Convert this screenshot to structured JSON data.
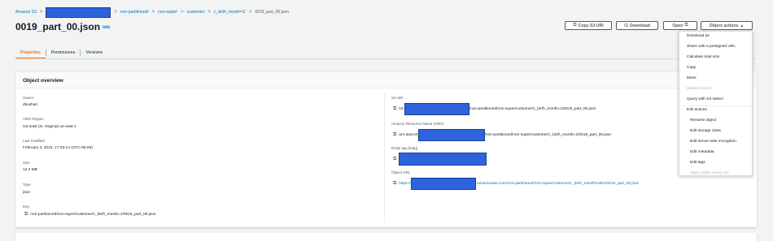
{
  "breadcrumb": {
    "root": "Amazon S3",
    "items": [
      "non-partitioned/",
      "non-super/",
      "customer/",
      "c_birth_month=1/"
    ],
    "current": "0019_part_00.json",
    "separator": ">"
  },
  "page": {
    "title": "0019_part_00.json",
    "info_label": "Info"
  },
  "toolbar": {
    "copy_s3_uri": "Copy S3 URI",
    "download": "Download",
    "open": "Open",
    "object_actions": "Object actions"
  },
  "tabs": [
    {
      "label": "Properties",
      "active": true
    },
    {
      "label": "Permissions",
      "active": false
    },
    {
      "label": "Versions",
      "active": false
    }
  ],
  "overview": {
    "title": "Object overview",
    "owner": {
      "label": "Owner",
      "value": "dkushari"
    },
    "region": {
      "label": "AWS Region",
      "value": "US East (N. Virginia) us-east-1"
    },
    "last_modified": {
      "label": "Last modified",
      "value": "February 3, 2022, 17:43:14 (UTC-05:00)"
    },
    "size": {
      "label": "Size",
      "value": "12.4 MB"
    },
    "type": {
      "label": "Type",
      "value": "json"
    },
    "key": {
      "label": "Key",
      "value": "non-partitioned/non-super/customer/c_birth_month=1/0019_part_00.json"
    },
    "s3_uri": {
      "label": "S3 URI",
      "prefix": "s3:",
      "suffix": "/non-partitioned/non-super/customer/c_birth_month=1/0019_part_00.json"
    },
    "arn": {
      "label": "Amazon Resource Name (ARN)",
      "prefix": "arn:aws:s3",
      "suffix": "/non-partitioned/non-super/customer/c_birth_month=1/0019_part_00.json"
    },
    "etag": {
      "label": "Entity tag (Etag)"
    },
    "object_url": {
      "label": "Object URL",
      "prefix": "https://",
      "suffix": ".amazonaws.com/non-partitioned/non-super/customer/c_birth_month%3D1/0019_part_00.json"
    }
  },
  "object_actions_menu": {
    "items": [
      {
        "label": "Download as",
        "disabled": false
      },
      {
        "label": "Share with a presigned URL",
        "disabled": false
      },
      {
        "label": "Calculate total size",
        "disabled": false
      },
      {
        "label": "Copy",
        "disabled": false
      },
      {
        "label": "Move",
        "disabled": false
      },
      {
        "label": "Initiate restore",
        "disabled": true
      },
      {
        "label": "Query with S3 Select",
        "disabled": false
      }
    ],
    "edit_header": "Edit actions",
    "edit_items": [
      {
        "label": "Rename object",
        "disabled": false
      },
      {
        "label": "Edit storage class",
        "disabled": false
      },
      {
        "label": "Edit server-side encryption",
        "disabled": false
      },
      {
        "label": "Edit metadata",
        "disabled": false
      },
      {
        "label": "Edit tags",
        "disabled": false
      },
      {
        "label": "Make public using ACL",
        "disabled": true
      }
    ]
  },
  "colors": {
    "link": "#0073bb",
    "accent": "#ec7211",
    "redaction": "#2d64de"
  }
}
